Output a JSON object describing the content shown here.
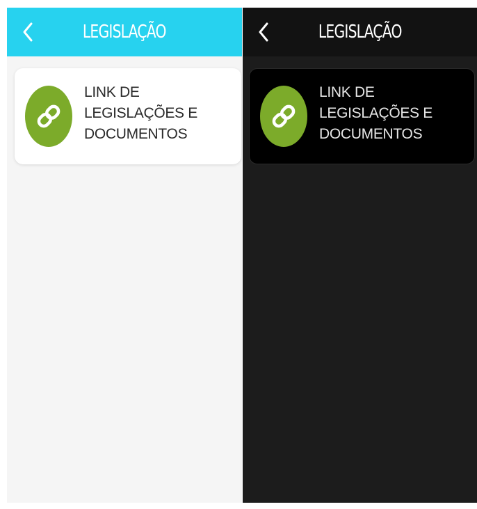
{
  "screens": [
    {
      "theme": "light",
      "header": {
        "title": "LEGISLAÇÃO",
        "back_icon": "chevron-left-icon",
        "color": "#27d2ef"
      },
      "card": {
        "icon": "link-icon",
        "icon_color": "#7cab2a",
        "label": "LINK DE LEGISLAÇÕES E DOCUMENTOS"
      }
    },
    {
      "theme": "dark",
      "header": {
        "title": "LEGISLAÇÃO",
        "back_icon": "chevron-left-icon",
        "color": "#121212"
      },
      "card": {
        "icon": "link-icon",
        "icon_color": "#7cab2a",
        "label": "LINK DE LEGISLAÇÕES E DOCUMENTOS"
      }
    }
  ]
}
